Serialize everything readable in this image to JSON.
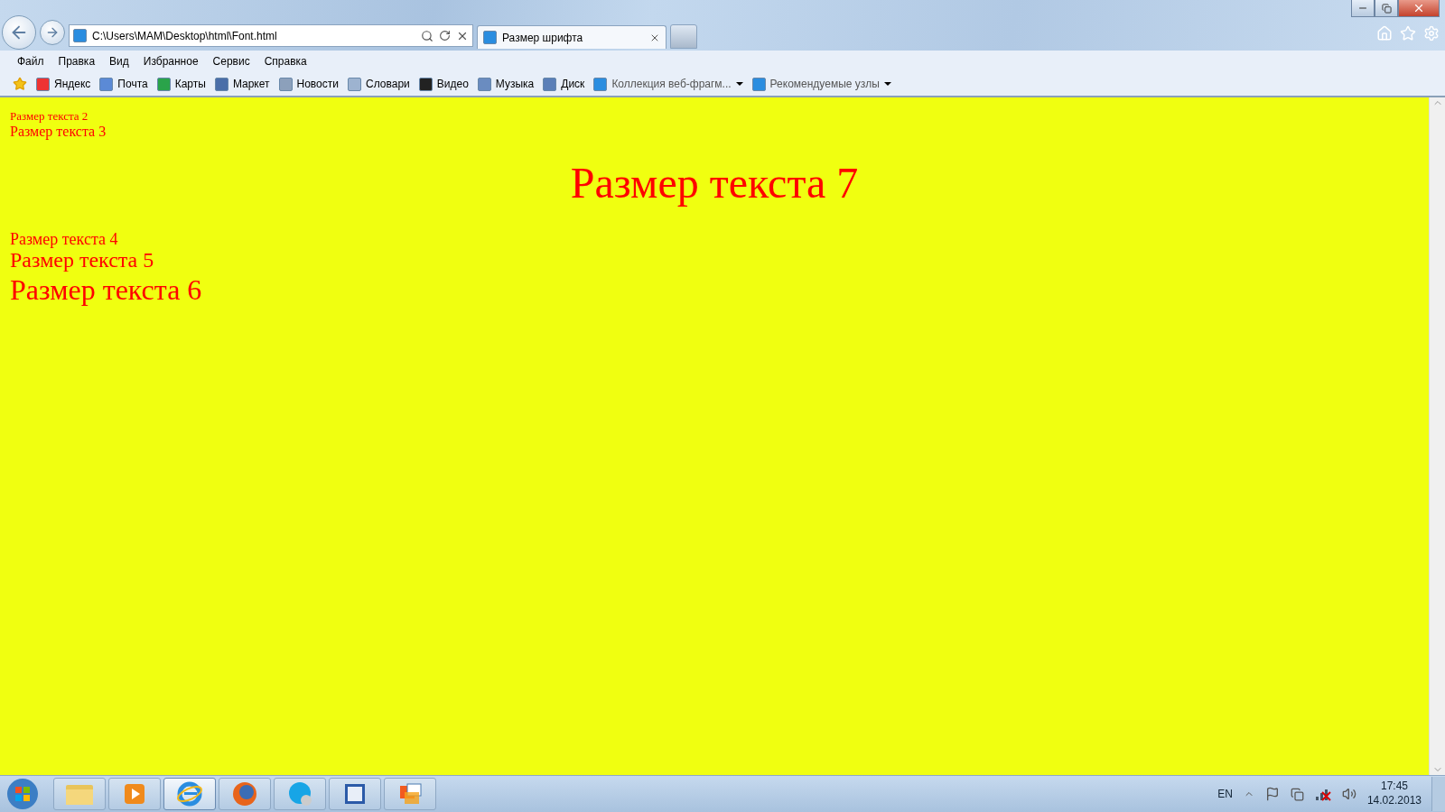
{
  "browser": {
    "back_enabled": true,
    "forward_enabled": true,
    "address": "C:\\Users\\MAM\\Desktop\\html\\Font.html",
    "tabs": [
      {
        "title": "Размер шрифта",
        "selected": true
      }
    ]
  },
  "menu": [
    "Файл",
    "Правка",
    "Вид",
    "Избранное",
    "Сервис",
    "Справка"
  ],
  "favorites": [
    {
      "label": "Яндекс",
      "dropdown": false
    },
    {
      "label": "Почта",
      "dropdown": false
    },
    {
      "label": "Карты",
      "dropdown": false
    },
    {
      "label": "Маркет",
      "dropdown": false
    },
    {
      "label": "Новости",
      "dropdown": false
    },
    {
      "label": "Словари",
      "dropdown": false
    },
    {
      "label": "Видео",
      "dropdown": false
    },
    {
      "label": "Музыка",
      "dropdown": false
    },
    {
      "label": "Диск",
      "dropdown": false
    },
    {
      "label": "Коллекция веб-фрагм...",
      "dropdown": true
    },
    {
      "label": "Рекомендуемые узлы",
      "dropdown": true
    }
  ],
  "page": {
    "lines": [
      {
        "text": "Размер текста 2",
        "kind": "tiny"
      },
      {
        "text": "Размер текста 3",
        "kind": "small"
      },
      {
        "text": "Размер текста 7",
        "kind": "huge"
      },
      {
        "text": "Размер текста 4",
        "kind": "medium"
      },
      {
        "text": "Размер текста 5",
        "kind": "large"
      },
      {
        "text": "Размер текста 6",
        "kind": "xlarge"
      }
    ]
  },
  "taskbar": {
    "apps": [
      {
        "selected": false
      },
      {
        "selected": false
      },
      {
        "selected": true
      },
      {
        "selected": false
      },
      {
        "selected": false
      },
      {
        "selected": false
      },
      {
        "selected": false
      }
    ],
    "language": "EN",
    "time": "17:45",
    "date": "14.02.2013"
  }
}
